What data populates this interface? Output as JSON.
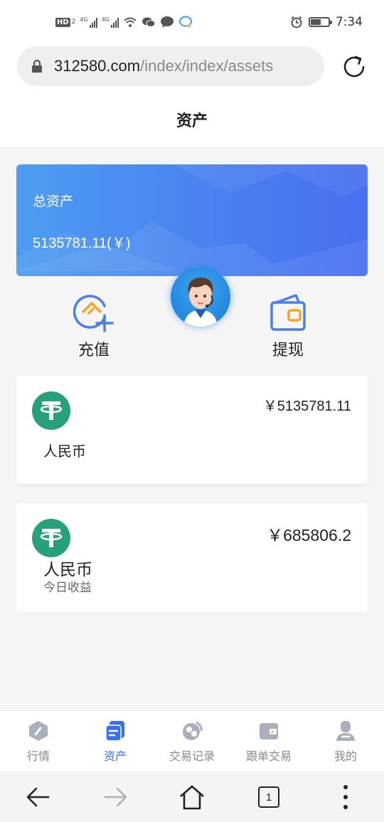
{
  "status_bar": {
    "badge": "HD",
    "badge_sub": "2",
    "network_1": "4G",
    "network_2": "4G",
    "time": "7:34",
    "battery_level": 0.6
  },
  "browser": {
    "url_host": "312580.com",
    "url_path": "/index/index/assets",
    "tab_count": "1"
  },
  "page": {
    "title": "资产"
  },
  "asset_card": {
    "label": "总资产",
    "value": "5135781.11(￥)"
  },
  "actions": {
    "recharge_label": "充值",
    "withdraw_label": "提现"
  },
  "coins": [
    {
      "name": "人民币",
      "amount": "￥5135781.11"
    },
    {
      "name": "人民币",
      "amount": "￥685806.2",
      "sub": "今日收益"
    }
  ],
  "tabs": [
    {
      "label": "行情",
      "active": false
    },
    {
      "label": "资产",
      "active": true
    },
    {
      "label": "交易记录",
      "active": false
    },
    {
      "label": "跟单交易",
      "active": false
    },
    {
      "label": "我的",
      "active": false
    }
  ],
  "colors": {
    "accent": "#3c6ff0",
    "card_gradient_start": "#4c9cf2",
    "card_gradient_end": "#4a6ef0",
    "usdt_green": "#26a17b",
    "icon_orange": "#f5a623"
  }
}
